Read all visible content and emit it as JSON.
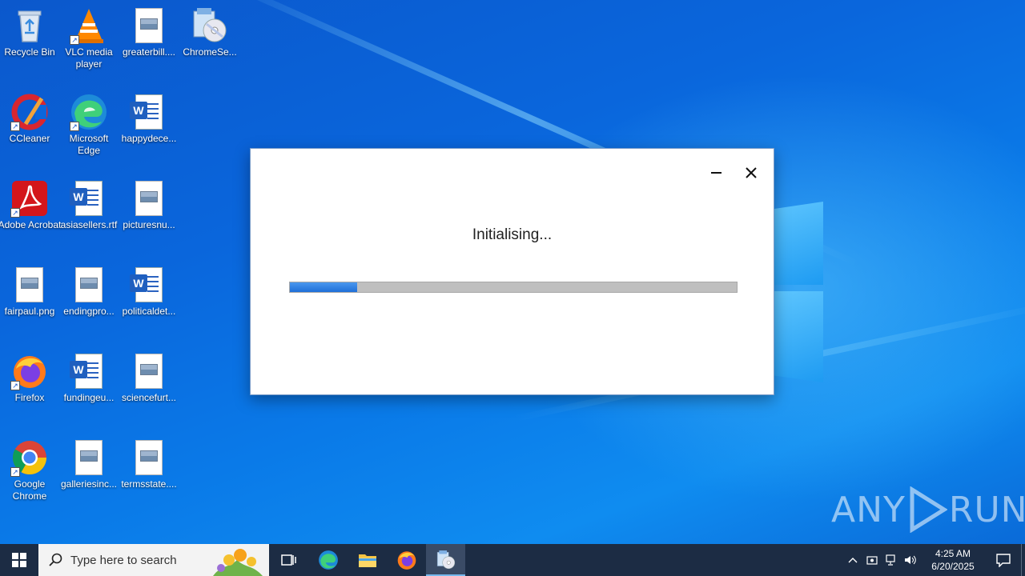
{
  "desktop": {
    "icons": [
      {
        "label": "Recycle Bin",
        "icon": "recycle-bin-icon"
      },
      {
        "label": "VLC media player",
        "icon": "vlc-icon"
      },
      {
        "label": "greaterbill....",
        "icon": "image-file-icon"
      },
      {
        "label": "ChromeSe...",
        "icon": "installer-icon"
      },
      {
        "label": "CCleaner",
        "icon": "ccleaner-icon"
      },
      {
        "label": "Microsoft Edge",
        "icon": "edge-icon"
      },
      {
        "label": "happydece...",
        "icon": "word-doc-icon"
      },
      {
        "label": "Adobe Acrobat",
        "icon": "acrobat-icon"
      },
      {
        "label": "asiasellers.rtf",
        "icon": "word-doc-icon"
      },
      {
        "label": "picturesnu...",
        "icon": "image-file-icon"
      },
      {
        "label": "fairpaul.png",
        "icon": "image-file-icon"
      },
      {
        "label": "endingpro...",
        "icon": "image-file-icon"
      },
      {
        "label": "politicaldet...",
        "icon": "word-doc-icon"
      },
      {
        "label": "Firefox",
        "icon": "firefox-icon"
      },
      {
        "label": "fundingeu...",
        "icon": "word-doc-icon"
      },
      {
        "label": "sciencefurt...",
        "icon": "image-file-icon"
      },
      {
        "label": "Google Chrome",
        "icon": "chrome-icon"
      },
      {
        "label": "galleriesinc...",
        "icon": "image-file-icon"
      },
      {
        "label": "termsstate....",
        "icon": "image-file-icon"
      }
    ]
  },
  "dialog": {
    "status": "Initialising...",
    "progress": 0.15
  },
  "taskbar": {
    "search_placeholder": "Type here to search",
    "apps": [
      "task-view",
      "edge",
      "file-explorer",
      "firefox",
      "installer"
    ],
    "active_app": "installer",
    "clock_time": "4:25 AM",
    "clock_date": "6/20/2025"
  },
  "watermark": {
    "left": "ANY",
    "right": "RUN"
  },
  "colors": {
    "progress_fill": "#2f7fe0",
    "progress_track": "#bfbfbf",
    "taskbar": "#1c2c44"
  }
}
